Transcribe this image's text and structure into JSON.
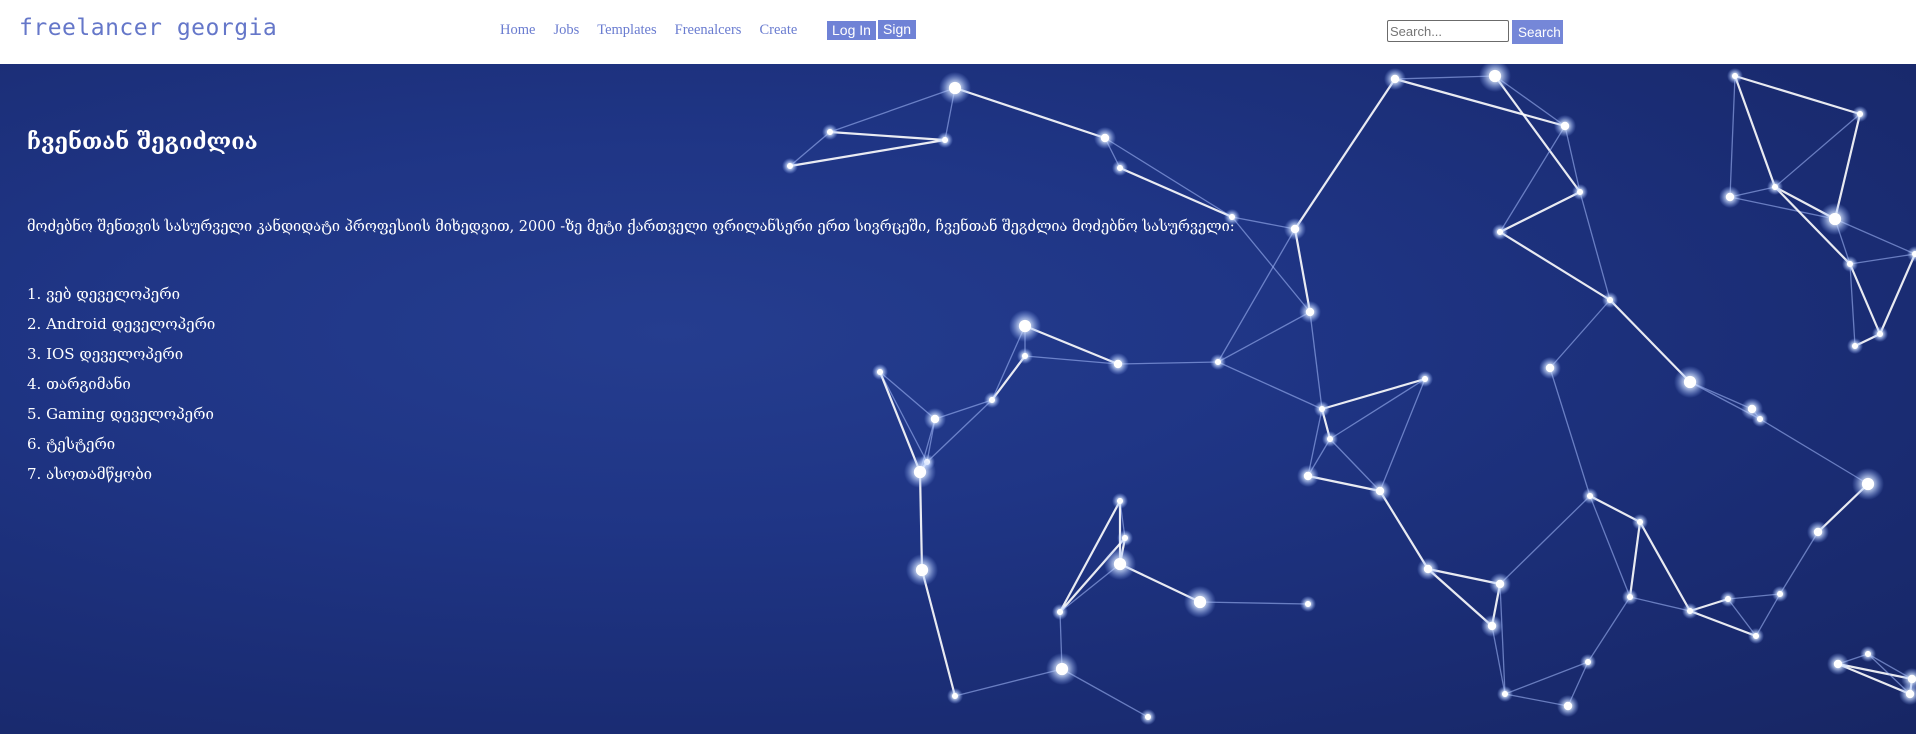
{
  "header": {
    "logo": "freelancer georgia",
    "nav": [
      "Home",
      "Jobs",
      "Templates",
      "Freenalcers",
      "Create"
    ],
    "login_label": "Log In",
    "sign_label": "Sign",
    "search": {
      "placeholder": "Search...",
      "value": "",
      "button_label": "Search"
    }
  },
  "hero": {
    "title": "ჩვენთან შეგიძლია",
    "text": "მოძებნო შენთვის სასურველი კანდიდატი პროფესიის მიხედვით, 2000 -ზე მეტი ქართველი ფრილანსერი ერთ სივრცეში, ჩვენთან შეგძლია მოძებნო სასურველი:",
    "items": [
      "1. ვებ დეველოპერი",
      "2. Android დეველოპერი",
      "3. IOS დეველოპერი",
      "4. თარგიმანი",
      "5. Gaming დეველოპერი",
      "6. ტესტერი",
      "7. ასოთამწყობი"
    ]
  },
  "colors": {
    "accent": "#6f82d6",
    "hero_bg": "#1f3585",
    "network": "#dfe8ff"
  }
}
